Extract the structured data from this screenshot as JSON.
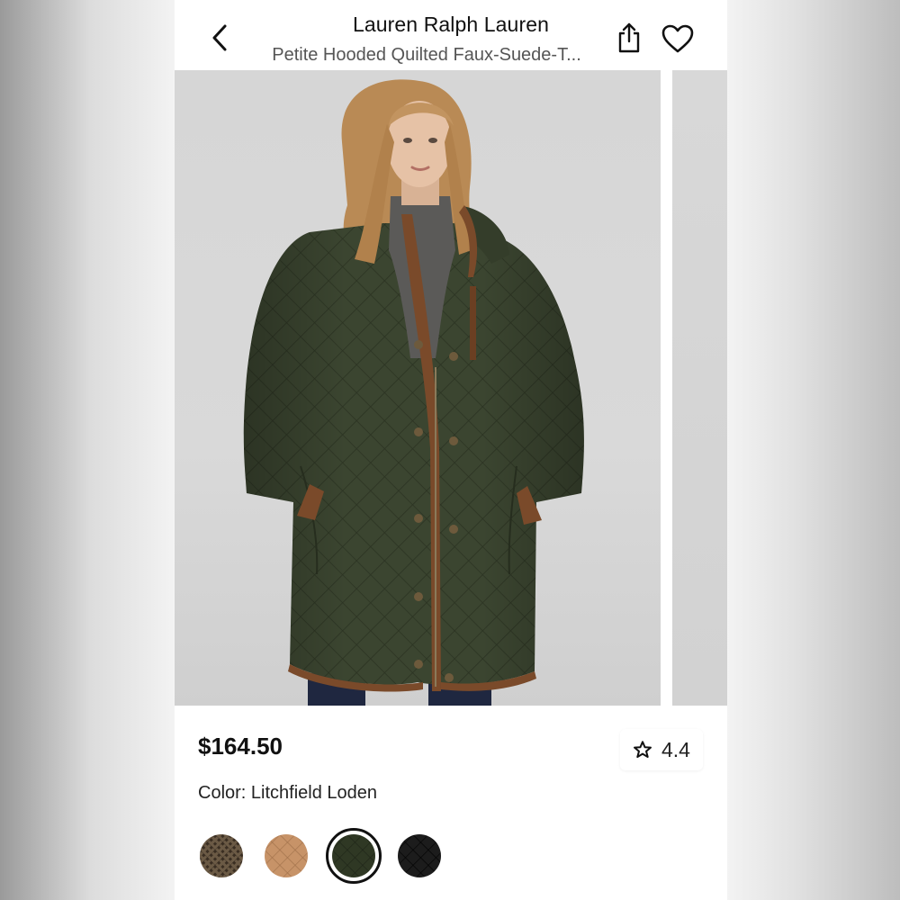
{
  "header": {
    "back_icon": "chevron-left-icon",
    "brand": "Lauren Ralph Lauren",
    "product_title": "Petite Hooded Quilted Faux-Suede-T...",
    "share_icon": "share-icon",
    "favorite_icon": "heart-outline-icon"
  },
  "gallery": {
    "images": [
      {
        "subject": "model-wearing-quilted-coat",
        "current": true
      },
      {
        "subject": "next-product-image",
        "current": false
      }
    ]
  },
  "product": {
    "price": "$164.50",
    "rating": "4.4",
    "rating_icon": "star-outline-icon",
    "color_label": "Color: Litchfield Loden",
    "swatches": [
      {
        "name": "houndstooth-brown",
        "color": "#5a4a3a",
        "selected": false
      },
      {
        "name": "camel",
        "color": "#c79368",
        "selected": false
      },
      {
        "name": "litchfield-loden",
        "color": "#2f3824",
        "selected": true
      },
      {
        "name": "black",
        "color": "#1c1c1c",
        "selected": false
      }
    ]
  },
  "colors": {
    "coat_green": "#3b4530",
    "trim_brown": "#7a4a2a",
    "sweater_gray": "#5b5a58",
    "hair_blonde": "#b98a55",
    "skin": "#e6c2a6",
    "jeans_navy": "#1f2740"
  }
}
